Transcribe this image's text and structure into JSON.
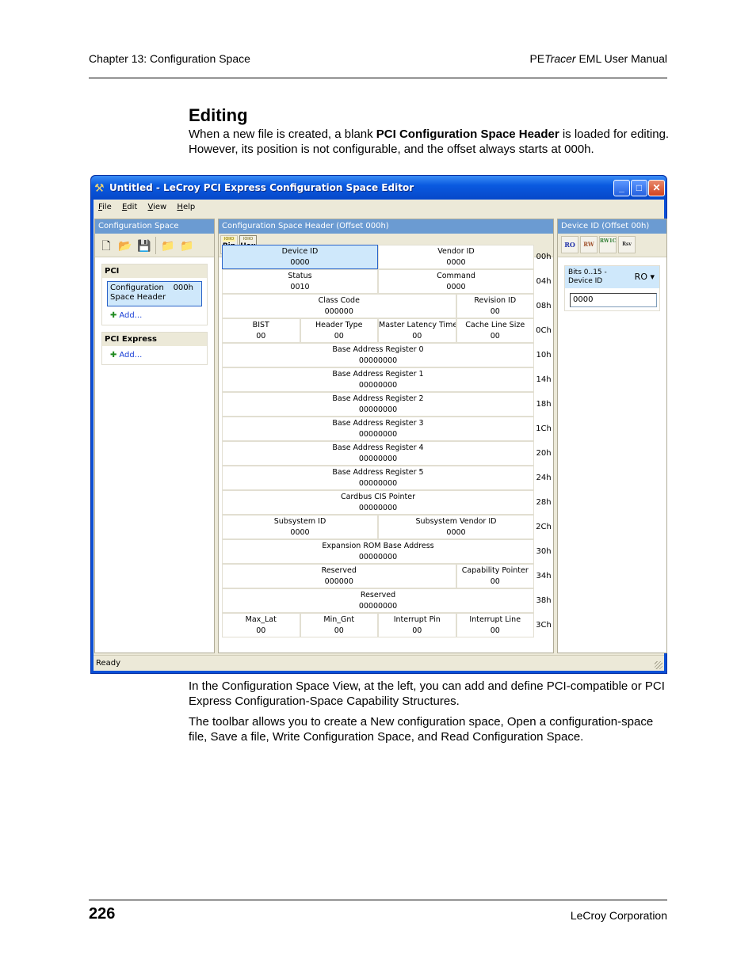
{
  "page": {
    "header_left": "Chapter 13: Configuration Space",
    "header_right_prefix": "PE",
    "header_right_italic": "Tracer",
    "header_right_suffix": " EML User Manual",
    "section_title": "Editing",
    "intro_before": "When a new file is created, a blank ",
    "intro_bold": "PCI Configuration Space Header",
    "intro_after": " is loaded for editing. However, its position is not configurable, and the offset always starts at 000h.",
    "para2": "In the Configuration Space View, at the left, you can add and define PCI-compatible or PCI Express Configuration-Space Capability Structures.",
    "para3": "The toolbar allows you to create a New configuration space, Open a configuration-space file, Save a file, Write Configuration Space, and Read Configuration Space.",
    "page_number": "226",
    "footer_right": "LeCroy Corporation"
  },
  "window": {
    "title": "Untitled - LeCroy PCI Express Configuration Space Editor",
    "title_icon": "tools-icon",
    "controls": {
      "minimize": "_",
      "maximize": "□",
      "close": "✕"
    },
    "menu": [
      {
        "mnemonic": "F",
        "rest": "ile"
      },
      {
        "mnemonic": "E",
        "rest": "dit"
      },
      {
        "mnemonic": "V",
        "rest": "iew"
      },
      {
        "mnemonic": "H",
        "rest": "elp"
      }
    ],
    "status": "Ready"
  },
  "left_pane": {
    "title": "Configuration Space",
    "toolbar": {
      "new": "🗋",
      "open": "📂",
      "save": "💾",
      "write": "📁",
      "read": "📁"
    },
    "groups": [
      {
        "title": "PCI",
        "item": {
          "name_line1": "Configuration",
          "name_line2": "Space Header",
          "offset": "000h"
        },
        "add": "Add..."
      },
      {
        "title": "PCI Express",
        "add": "Add..."
      }
    ]
  },
  "mid_pane": {
    "title": "Configuration Space Header (Offset 000h)",
    "toolbar": {
      "bin": {
        "bits": "IOIIO",
        "label": "Bin"
      },
      "hex": {
        "bits": "IOIIO",
        "label": "Hex"
      }
    },
    "rows": [
      {
        "offset": "00h",
        "cells": [
          {
            "name": "Device ID",
            "value": "0000",
            "span": 2,
            "selected": true
          },
          {
            "name": "Vendor ID",
            "value": "0000",
            "span": 2
          }
        ]
      },
      {
        "offset": "04h",
        "cells": [
          {
            "name": "Status",
            "value": "0010",
            "span": 2
          },
          {
            "name": "Command",
            "value": "0000",
            "span": 2
          }
        ]
      },
      {
        "offset": "08h",
        "cells": [
          {
            "name": "Class Code",
            "value": "000000",
            "span": 3
          },
          {
            "name": "Revision ID",
            "value": "00",
            "span": 1
          }
        ]
      },
      {
        "offset": "0Ch",
        "cells": [
          {
            "name": "BIST",
            "value": "00",
            "span": 1
          },
          {
            "name": "Header Type",
            "value": "00",
            "span": 1
          },
          {
            "name": "Master Latency Timer",
            "value": "00",
            "span": 1
          },
          {
            "name": "Cache Line Size",
            "value": "00",
            "span": 1
          }
        ]
      },
      {
        "offset": "10h",
        "cells": [
          {
            "name": "Base Address Register 0",
            "value": "00000000",
            "span": 4
          }
        ]
      },
      {
        "offset": "14h",
        "cells": [
          {
            "name": "Base Address Register 1",
            "value": "00000000",
            "span": 4
          }
        ]
      },
      {
        "offset": "18h",
        "cells": [
          {
            "name": "Base Address Register 2",
            "value": "00000000",
            "span": 4
          }
        ]
      },
      {
        "offset": "1Ch",
        "cells": [
          {
            "name": "Base Address Register 3",
            "value": "00000000",
            "span": 4
          }
        ]
      },
      {
        "offset": "20h",
        "cells": [
          {
            "name": "Base Address Register 4",
            "value": "00000000",
            "span": 4
          }
        ]
      },
      {
        "offset": "24h",
        "cells": [
          {
            "name": "Base Address Register 5",
            "value": "00000000",
            "span": 4
          }
        ]
      },
      {
        "offset": "28h",
        "cells": [
          {
            "name": "Cardbus CIS Pointer",
            "value": "00000000",
            "span": 4
          }
        ]
      },
      {
        "offset": "2Ch",
        "cells": [
          {
            "name": "Subsystem ID",
            "value": "0000",
            "span": 2
          },
          {
            "name": "Subsystem Vendor ID",
            "value": "0000",
            "span": 2
          }
        ]
      },
      {
        "offset": "30h",
        "cells": [
          {
            "name": "Expansion ROM Base Address",
            "value": "00000000",
            "span": 4
          }
        ]
      },
      {
        "offset": "34h",
        "cells": [
          {
            "name": "Reserved",
            "value": "000000",
            "span": 3
          },
          {
            "name": "Capability Pointer",
            "value": "00",
            "span": 1
          }
        ]
      },
      {
        "offset": "38h",
        "cells": [
          {
            "name": "Reserved",
            "value": "00000000",
            "span": 4
          }
        ]
      },
      {
        "offset": "3Ch",
        "cells": [
          {
            "name": "Max_Lat",
            "value": "00",
            "span": 1
          },
          {
            "name": "Min_Gnt",
            "value": "00",
            "span": 1
          },
          {
            "name": "Interrupt Pin",
            "value": "00",
            "span": 1
          },
          {
            "name": "Interrupt Line",
            "value": "00",
            "span": 1
          }
        ]
      }
    ]
  },
  "right_pane": {
    "title": "Device ID (Offset 00h)",
    "toolbar": [
      {
        "label": "RO",
        "color": "#2233aa"
      },
      {
        "label": "RW",
        "color": "#a0522d"
      },
      {
        "label": "RW1C",
        "color": "#2e7d32"
      },
      {
        "label": "Rsv",
        "color": "#333333"
      }
    ],
    "field": {
      "label_line1": "Bits 0..15 -",
      "label_line2": "Device ID",
      "mode": "RO ▾",
      "value": "0000"
    }
  }
}
